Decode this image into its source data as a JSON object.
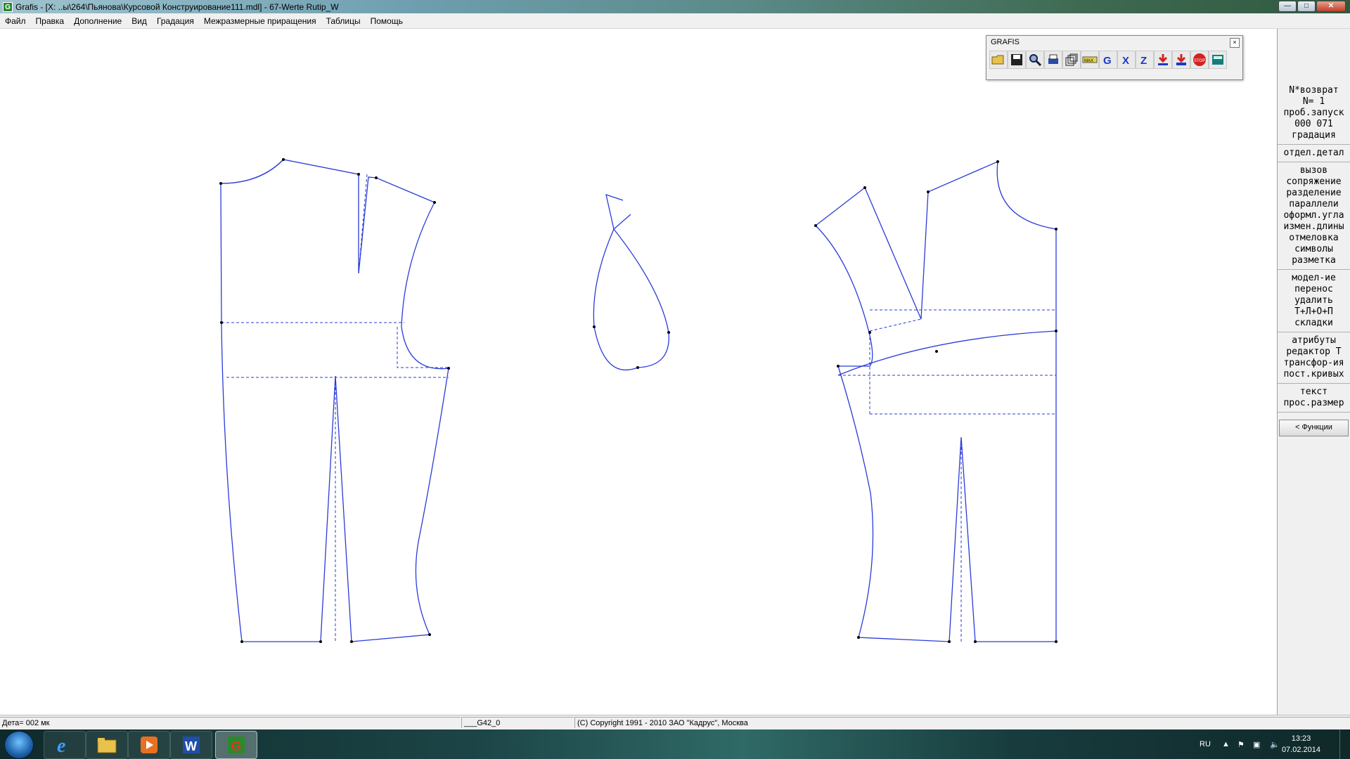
{
  "window": {
    "title": "Grafis - [X: ..ы\\264\\Пьянова\\Курсовой Конструирование111.mdl] - 67-Werte Rutip_W",
    "app_icon_label": "G",
    "buttons": {
      "minimize": "—",
      "maximize": "□",
      "close": "✕"
    }
  },
  "menu": [
    "Файл",
    "Правка",
    "Дополнение",
    "Вид",
    "Градация",
    "Межразмерные приращения",
    "Таблицы",
    "Помощь"
  ],
  "toolbox": {
    "title": "GRAFIS",
    "close": "×",
    "icons": [
      "folder-open-icon",
      "save-icon",
      "zoom-icon",
      "print-icon",
      "layers-icon",
      "ruler-icon",
      "grafis-g-icon",
      "x-icon",
      "z-icon",
      "import-icon",
      "export-icon",
      "stop-icon",
      "calculator-icon"
    ],
    "ruler_label": "MAX",
    "g_label": "G",
    "x_label": "X",
    "z_label": "Z",
    "stop_label": "STOP"
  },
  "side_panel": {
    "group1": [
      "N*возврат",
      "N=  1",
      "проб.запуск",
      "000 071",
      "градация"
    ],
    "group2": [
      "отдел.детал"
    ],
    "group3": [
      "вызов",
      "сопряжение",
      "разделение",
      "параллели",
      "оформл.угла",
      "измен.длины",
      "отмеловка",
      "символы",
      "разметка"
    ],
    "group4": [
      "модел-ие",
      "перенос",
      "удалить",
      "Т+Л+О+П",
      "складки"
    ],
    "group5": [
      "атрибуты",
      "редактор Т",
      "трансфор-ия",
      "пост.кривых"
    ],
    "group6": [
      "текст",
      "прос.размер"
    ],
    "functions_button": "< Функции"
  },
  "status": {
    "detail": "Дета= 002  мк",
    "field2": "___G42_0",
    "copyright": "(C) Copyright 1991 - 2010 ЗАО \"Кадрус\", Москва"
  },
  "taskbar": {
    "apps": [
      "windows-start",
      "internet-explorer",
      "file-explorer",
      "media-player",
      "microsoft-word",
      "grafis"
    ],
    "word_label": "W",
    "grafis_label": "G",
    "ie_label": "e",
    "lang": "RU",
    "time": "13:23",
    "date": "07.02.2014"
  },
  "colors": {
    "pattern_line": "#2a3bd8",
    "dashed_line": "#2a3bd8",
    "point": "#000000"
  }
}
